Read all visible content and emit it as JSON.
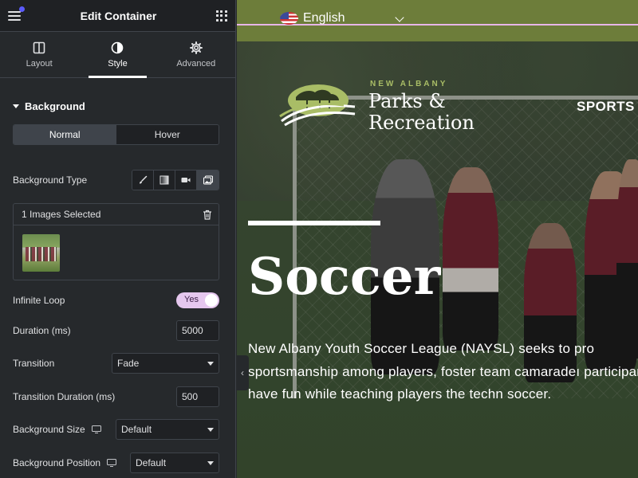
{
  "panel": {
    "title": "Edit Container",
    "tabs": [
      {
        "label": "Layout",
        "icon": "layout-icon"
      },
      {
        "label": "Style",
        "icon": "style-contrast-icon",
        "active": true
      },
      {
        "label": "Advanced",
        "icon": "gear-icon"
      }
    ],
    "section_title": "Background",
    "state_tabs": {
      "normal": "Normal",
      "hover": "Hover",
      "active": "Normal"
    },
    "background_type": {
      "label": "Background Type",
      "options": [
        "brush-icon",
        "gradient-icon",
        "video-icon",
        "slideshow-icon"
      ],
      "selected": "slideshow-icon"
    },
    "gallery": {
      "label": "1 Images Selected",
      "count": 1
    },
    "infinite_loop": {
      "label": "Infinite Loop",
      "value": "Yes"
    },
    "duration": {
      "label": "Duration (ms)",
      "value": "5000"
    },
    "transition": {
      "label": "Transition",
      "value": "Fade"
    },
    "transition_duration": {
      "label": "Transition Duration (ms)",
      "value": "500"
    },
    "bg_size": {
      "label": "Background Size",
      "value": "Default"
    },
    "bg_position": {
      "label": "Background Position",
      "value": "Default"
    },
    "accent_color": "#e5c7ee"
  },
  "preview": {
    "language": "English",
    "brand_small": "NEW ALBANY",
    "brand_line1": "Parks &",
    "brand_line2": "Recreation",
    "nav_item": "SPORTS",
    "hero_title": "Soccer",
    "hero_description": "New Albany Youth Soccer League (NAYSL) seeks to pro sportsmanship among players, foster team camaradeı participants have fun while teaching players the techn soccer.",
    "topbar_color": "#6d7d3a",
    "brand_green": "#a9bd66"
  }
}
